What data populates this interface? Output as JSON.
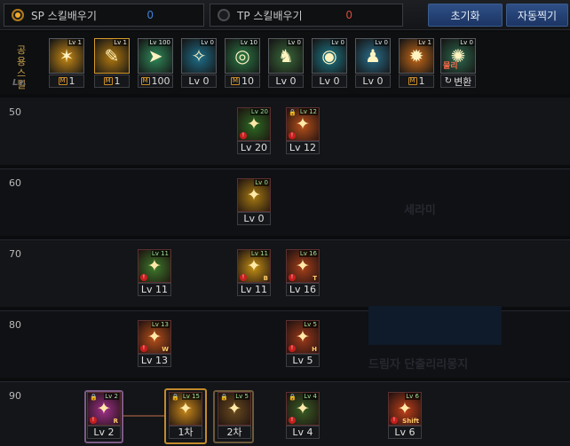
{
  "topbar": {
    "sp": {
      "label": "SP 스킬배우기",
      "points": "0",
      "points_color": "#3f7fd6"
    },
    "tp": {
      "label": "TP 스킬배우기",
      "points": "0",
      "points_color": "#d44a3a"
    },
    "reset_label": "초기화",
    "auto_label": "자동찍기"
  },
  "common": {
    "label": "공용 스킬",
    "lv_label": "Lv.",
    "skills": [
      {
        "tag": "Lv 1",
        "level": "1",
        "badge": true,
        "icon": "claw-icon",
        "color": "#c98a15"
      },
      {
        "tag": "Lv 1",
        "level": "1",
        "badge": true,
        "icon": "feather-icon",
        "color": "#b37a10"
      },
      {
        "tag": "Lv 100",
        "level": "100",
        "badge": true,
        "icon": "sprint-icon",
        "color": "#2f8a5a"
      },
      {
        "tag": "Lv 0",
        "level": "Lv 0",
        "badge": false,
        "icon": "wings-icon",
        "color": "#1e6f8a"
      },
      {
        "tag": "Lv 10",
        "level": "10",
        "badge": true,
        "icon": "target-icon",
        "color": "#2c7a46"
      },
      {
        "tag": "Lv 0",
        "level": "Lv 0",
        "badge": false,
        "icon": "figure-icon",
        "color": "#3b6a3a"
      },
      {
        "tag": "Lv 0",
        "level": "Lv 0",
        "badge": false,
        "icon": "eye-icon",
        "color": "#1e7a8a"
      },
      {
        "tag": "Lv 0",
        "level": "Lv 0",
        "badge": false,
        "icon": "man-icon",
        "color": "#2a6f8c"
      },
      {
        "tag": "Lv 1",
        "level": "1",
        "badge": true,
        "icon": "fire-icon",
        "color": "#c86a18"
      },
      {
        "tag": "Lv 0",
        "level": "변환",
        "badge": false,
        "icon": "convert-icon",
        "color": "#2e6a4e",
        "overlay": "물리"
      }
    ]
  },
  "rows": [
    {
      "level": "50"
    },
    {
      "level": "60"
    },
    {
      "level": "70"
    },
    {
      "level": "80"
    },
    {
      "level": "90"
    }
  ],
  "skills": [
    {
      "name": "skill-50-a",
      "tag": "Lv 20",
      "level": "Lv 20",
      "color": "#2d6a22",
      "warn": true,
      "lock": false,
      "key": ""
    },
    {
      "name": "skill-50-b",
      "tag": "Lv 12",
      "level": "Lv 12",
      "color": "#b8501a",
      "warn": true,
      "lock": true,
      "key": ""
    },
    {
      "name": "skill-60-a",
      "tag": "Lv 0",
      "level": "Lv 0",
      "color": "#a67a12",
      "warn": false,
      "lock": false,
      "key": ""
    },
    {
      "name": "skill-70-a",
      "tag": "Lv 11",
      "level": "Lv 11",
      "color": "#3e7a2a",
      "warn": true,
      "lock": false,
      "key": ""
    },
    {
      "name": "skill-70-b",
      "tag": "Lv 11",
      "level": "Lv 11",
      "color": "#c49015",
      "warn": true,
      "lock": false,
      "key": "B"
    },
    {
      "name": "skill-70-c",
      "tag": "Lv 16",
      "level": "Lv 16",
      "color": "#a8401a",
      "warn": true,
      "lock": false,
      "key": "T"
    },
    {
      "name": "skill-80-a",
      "tag": "Lv 13",
      "level": "Lv 13",
      "color": "#b8501a",
      "warn": true,
      "lock": false,
      "key": "W"
    },
    {
      "name": "skill-80-b",
      "tag": "Lv 5",
      "level": "Lv 5",
      "color": "#9e3a1a",
      "warn": true,
      "lock": false,
      "key": "H"
    },
    {
      "name": "skill-90-a",
      "tag": "Lv 2",
      "level": "Lv 2",
      "color": "#a0308a",
      "warn": true,
      "lock": true,
      "key": "R"
    },
    {
      "name": "skill-90-b",
      "tag": "Lv 15",
      "level": "1차",
      "color": "#c8881a",
      "warn": false,
      "lock": true,
      "key": ""
    },
    {
      "name": "skill-90-c",
      "tag": "Lv 5",
      "level": "2차",
      "color": "#6a4a1e",
      "warn": false,
      "lock": true,
      "key": ""
    },
    {
      "name": "skill-90-d",
      "tag": "Lv 4",
      "level": "Lv 4",
      "color": "#3a5e24",
      "warn": true,
      "lock": true,
      "key": ""
    },
    {
      "name": "skill-90-e",
      "tag": "Lv 6",
      "level": "Lv 6",
      "color": "#c0401a",
      "warn": true,
      "lock": false,
      "key": "Shift"
    }
  ],
  "ghost": {
    "text1": "세라미",
    "text2": "드림자 단출리리몽지"
  }
}
